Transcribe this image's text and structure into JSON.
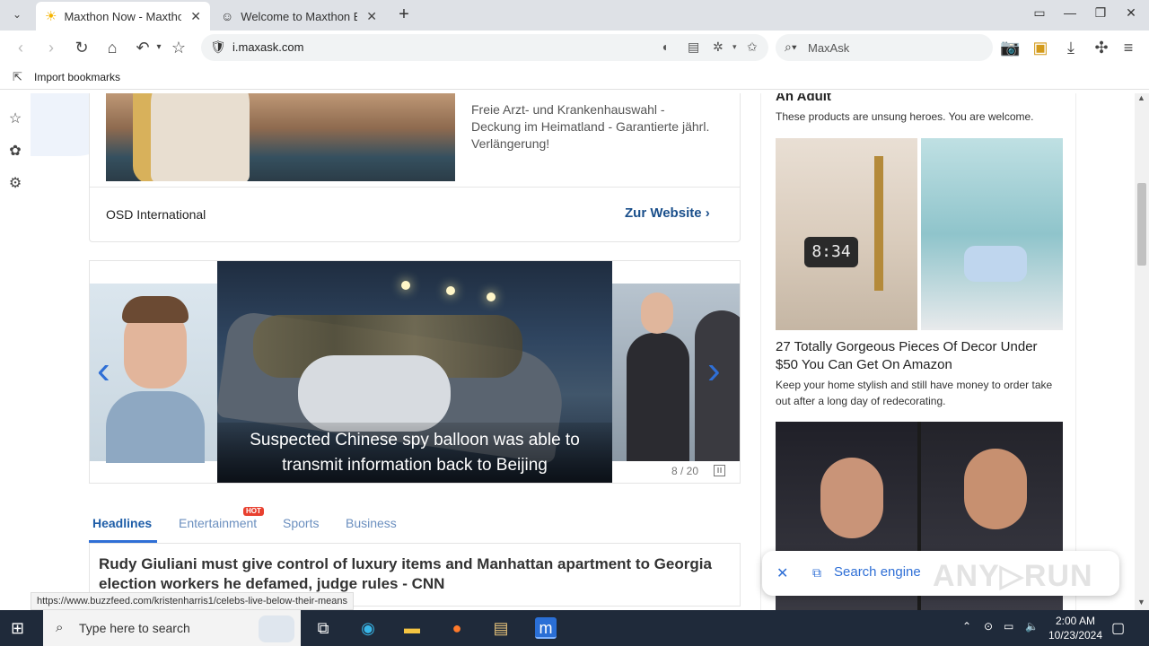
{
  "tabs": [
    {
      "title": "Maxthon Now - Maxtho",
      "icon": "sun-icon",
      "active": true
    },
    {
      "title": "Welcome to Maxthon Br",
      "icon": "maxthon-face-icon",
      "active": false
    }
  ],
  "address_bar": {
    "url": "i.maxask.com"
  },
  "search_box": {
    "placeholder": "MaxAsk"
  },
  "bookmarks_bar": {
    "import_label": "Import bookmarks"
  },
  "ad_card": {
    "text": "Freie Arzt- und Krankenhauswahl - Deckung im Heimatland - Garantierte jährl. Verlängerung!",
    "brand": "OSD International",
    "link": "Zur Website"
  },
  "carousel": {
    "caption": "Suspected Chinese spy balloon was able to transmit information back to Beijing",
    "counter": "8 / 20"
  },
  "news_tabs": [
    {
      "label": "Headlines",
      "active": true
    },
    {
      "label": "Entertainment",
      "badge": "HOT"
    },
    {
      "label": "Sports"
    },
    {
      "label": "Business"
    }
  ],
  "headline": "Rudy Giuliani must give control of luxury items and Manhattan apartment to Georgia election workers he defamed, judge rules - CNN",
  "right_column": {
    "prev_title_cut": "An Adult",
    "prev_sub": "These products are unsung heroes. You are welcome.",
    "article_title": "27 Totally Gorgeous Pieces Of Decor Under $50 You Can Get On Amazon",
    "article_sub": "Keep your home stylish and still have money to order take out after a long day of redecorating.",
    "clock_text": "8:34"
  },
  "toast": {
    "label": "Search engine",
    "watermark": "ANY RUN"
  },
  "status_url": "https://www.buzzfeed.com/kristenharris1/celebs-live-below-their-means",
  "taskbar": {
    "search_placeholder": "Type here to search",
    "time": "2:00 AM",
    "date": "10/23/2024"
  },
  "colors": {
    "accent": "#2f6fd6",
    "link": "#1a4f8b",
    "hot": "#e8402f",
    "taskbar": "#1f2a3a"
  }
}
